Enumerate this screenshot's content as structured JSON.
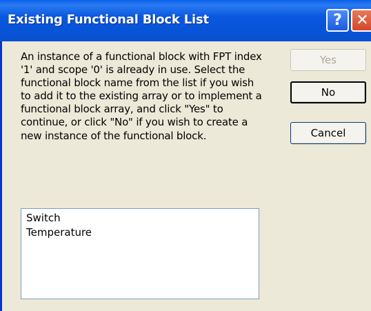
{
  "window": {
    "title": "Existing Functional Block List",
    "help_glyph": "?",
    "close_glyph": "✕"
  },
  "message": "An instance of a functional block with FPT index '1' and scope '0' is already in use. Select the functional block name from the list if you wish to add it to the existing array or to implement a functional block array, and click \"Yes\" to continue, or click \"No\" if you wish to create a new instance of the functional block.",
  "buttons": {
    "yes": "Yes",
    "no": "No",
    "cancel": "Cancel"
  },
  "list": {
    "items": [
      "Switch",
      "Temperature"
    ]
  },
  "colors": {
    "titlebar": "#0853d6",
    "window_bg": "#ece9d8",
    "close_button": "#d2472a",
    "disabled_text": "#aca899"
  }
}
